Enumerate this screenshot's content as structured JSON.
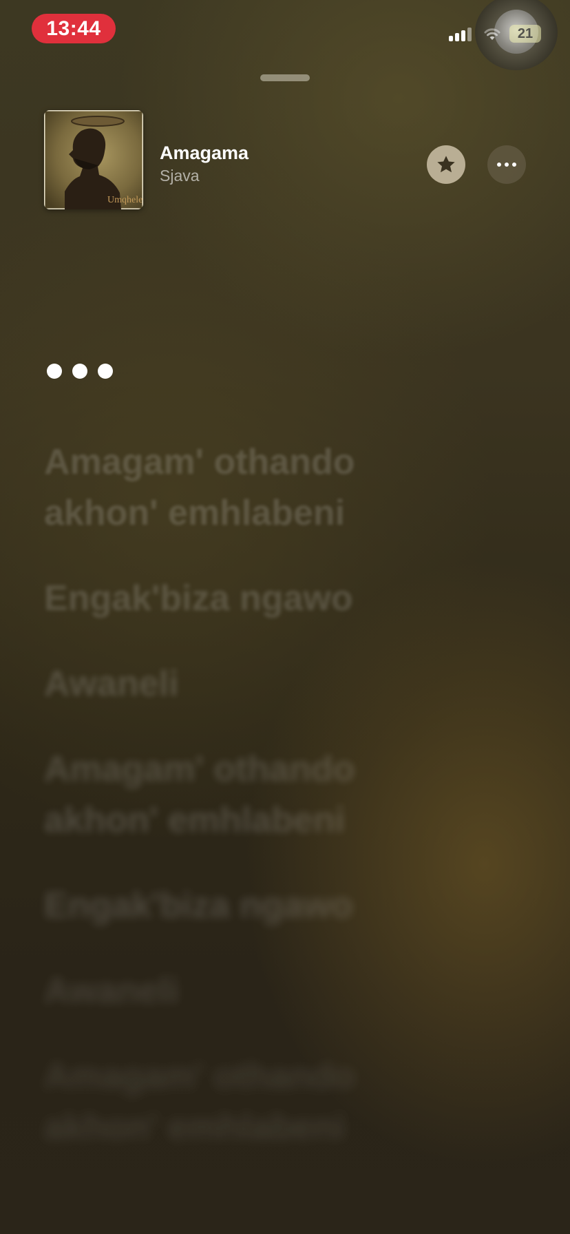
{
  "status_bar": {
    "time": "13:44",
    "battery_level": "21",
    "signal_icon": "cellular-signal-icon",
    "wifi_icon": "wifi-icon"
  },
  "now_playing": {
    "title": "Amagama",
    "artist": "Sjava",
    "artwork_text": "Umqhele",
    "favorite_icon": "star-icon",
    "more_icon": "ellipsis-icon"
  },
  "lyrics": {
    "interlude_icon": "ellipsis-dots",
    "lines": [
      "Amagam' othando akhon' emhlabeni",
      "Engak'biza ngawo",
      "Awaneli",
      "Amagam' othando akhon' emhlabeni",
      "Engak'biza ngawo",
      "Awaneli",
      "Amagam' othando akhon' emhlabeni"
    ]
  }
}
